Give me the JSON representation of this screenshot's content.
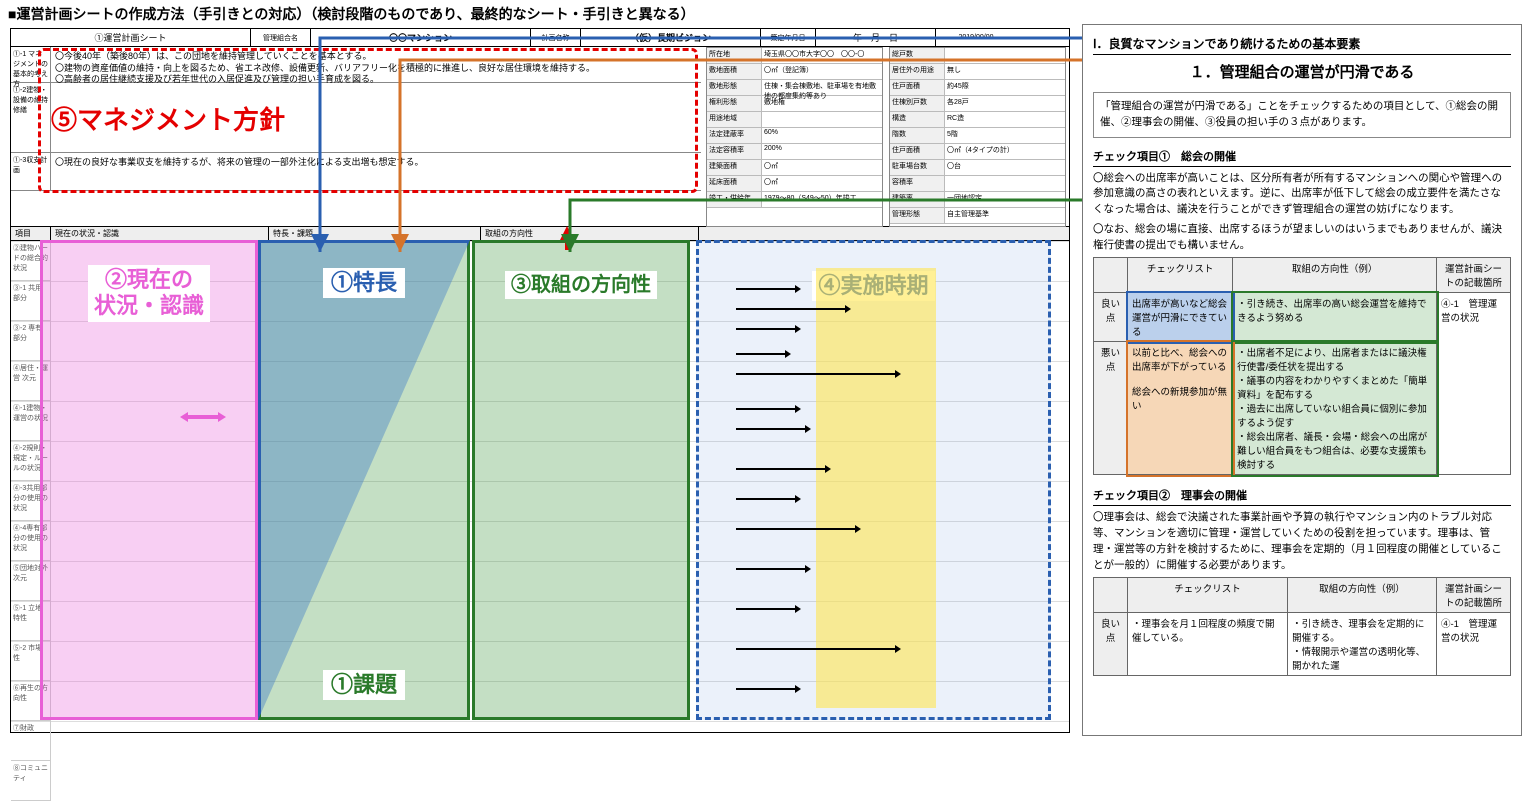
{
  "page_title": "■運営計画シートの作成方法（手引きとの対応）（検討段階のものであり、最終的なシート・手引きと異なる）",
  "sheet": {
    "header": {
      "label": "①運営計画シート",
      "mgmt_org_label": "管理組合名",
      "mgmt_org": "〇〇マンション",
      "plan_name_label": "計画名称",
      "plan_name": "（仮）長期ビジョン",
      "date_label": "策定年月日",
      "date_value": "年　月　日",
      "rev": "2019/00/00"
    },
    "policy": {
      "row1_label": "①-1 マネジメントの基本的考え方",
      "row1_text": "〇今後40年（築後80年）は、この団地を維持管理していくことを基本とする。\n〇建物の資産価値の維持・向上を図るため、省エネ改修、設備更新、バリアフリー化を積極的に推進し、良好な居住環境を維持する。\n〇高齢者の居住継続支援及び若年世代の入居促進及び管理の担い手育成を図る。",
      "row2_label": "①-2建物・設備の維持修繕",
      "row2_text": "",
      "row3_label": "①-3収支計画",
      "row3_text": "〇現在の良好な事業収支を維持するが、将来の管理の一部外注化による支出増も想定する。"
    },
    "spec_left": [
      {
        "k": "所在地",
        "v": "埼玉県〇〇市大字〇〇　〇〇-〇"
      },
      {
        "k": "敷地面積",
        "v": "〇㎡（登記簿）"
      },
      {
        "k": "敷地形態",
        "v": "住棟・集会棟敷地、駐車場を有地敷地の都度集約等あり"
      },
      {
        "k": "権利形態",
        "v": "敷地権"
      },
      {
        "k": "用途地域",
        "v": ""
      },
      {
        "k": "法定建蔽率",
        "v": "60%"
      },
      {
        "k": "法定容積率",
        "v": "200%"
      },
      {
        "k": "建築面積",
        "v": "〇㎡"
      },
      {
        "k": "延床面積",
        "v": "〇㎡"
      },
      {
        "k": "竣工・供給年",
        "v": "1979～80（S49～50）年竣工"
      }
    ],
    "spec_right": [
      {
        "k": "総戸数",
        "v": ""
      },
      {
        "k": "居住外の用途",
        "v": "無し"
      },
      {
        "k": "住戸面積",
        "v": "約45際"
      },
      {
        "k": "住棟別戸数",
        "v": "各28戸"
      },
      {
        "k": "構造",
        "v": "RC造"
      },
      {
        "k": "階数",
        "v": "5階"
      },
      {
        "k": "住戸面積",
        "v": "〇㎡（4タイプの計）"
      },
      {
        "k": "駐車場台数",
        "v": "〇台"
      },
      {
        "k": "容積率",
        "v": ""
      },
      {
        "k": "建築率",
        "v": "一団地認定"
      },
      {
        "k": "管理形態",
        "v": "自主管理基準"
      }
    ],
    "col_strip": {
      "c1": "項目",
      "c2": "現在の状況・認識",
      "c3": "特長・課題",
      "c4": "取組の方向性",
      "c5": ""
    },
    "row_labels": [
      "②建物ハードの総合的状況",
      "③-1 共用部分",
      "③-2 専有部分",
      "④居住・運営 次元",
      "④-1建物・運営の状況",
      "④-2規則・規定・ルールの状況",
      "④-3共用部分の使用の状況",
      "④-4専有部分の使用の状況",
      "⑤団地対外 次元",
      "⑤-1 立地特性",
      "⑤-2 市場性",
      "⑥再生の方向性",
      "⑦財政",
      "⑧コミュニティ"
    ]
  },
  "overlays": {
    "o5": "⑤マネジメント方針",
    "o2": "②現在の\n状況・認識",
    "o1a": "①特長",
    "o1b": "①課題",
    "o3": "③取組の方向性",
    "o4": "④実施時期"
  },
  "connector_colors": {
    "blue": "#2a5fb0",
    "orange": "#d5732a",
    "green": "#2a7a2a"
  },
  "guide": {
    "heading_small": "Ⅰ．良質なマンションであり続けるための基本要素",
    "heading_main": "１．管理組合の運営が円滑である",
    "intro": "「管理組合の運営が円滑である」ことをチェックするための項目として、①総会の開催、②理事会の開催、③役員の担い手の３点があります。",
    "check1_title": "チェック項目①　総会の開催",
    "check1_p1": "〇総会への出席率が高いことは、区分所有者が所有するマンションへの関心や管理への参加意識の高さの表れといえます。逆に、出席率が低下して総会の成立要件を満たさなくなった場合は、議決を行うことができず管理組合の運営の妨げになります。",
    "check1_p2": "〇なお、総会の場に直接、出席するほうが望ましいのはいうまでもありませんが、議決権行使書の提出でも構いません。",
    "tbl1": {
      "h_check": "チェックリスト",
      "h_dir": "取組の方向性（例）",
      "h_loc": "運営計画シートの記載箇所",
      "good_label": "良い点",
      "good_check": "出席率が高いなど総会運営が円滑にできている",
      "good_dir": "・引き続き、出席率の高い総会運営を維持できるよう努める",
      "bad_label": "悪い点",
      "bad_check": "以前と比べ、総会への出席率が下がっている\n\n総会への新規参加が無い",
      "bad_dir": "・出席者不足により、出席者またはに議決権行使書/委任状を提出する\n・議事の内容をわかりやすくまとめた「簡単資料」を配布する\n・過去に出席していない組合員に個別に参加するよう促す\n・総会出席者、議長・会場・総会への出席が難しい組合員をもつ組合は、必要な支援策も検討する",
      "loc": "④-1　管理運営の状況"
    },
    "check2_title": "チェック項目②　理事会の開催",
    "check2_p": "〇理事会は、総会で決議された事業計画や予算の執行やマンション内のトラブル対応等、マンションを適切に管理・運営していくための役割を担っています。理事は、管理・運営等の方針を検討するために、理事会を定期的（月１回程度の開催としていることが一般的）に開催する必要があります。",
    "tbl2": {
      "h_check": "チェックリスト",
      "h_dir": "取組の方向性（例）",
      "h_loc": "運営計画シートの記載箇所",
      "good_label": "良い点",
      "good_check": "・理事会を月１回程度の頻度で開催している。",
      "good_dir": "・引き続き、理事会を定期的に開催する。\n・情報開示や運営の透明化等、開かれた運",
      "loc": "④-1　管理運営の状況"
    }
  }
}
